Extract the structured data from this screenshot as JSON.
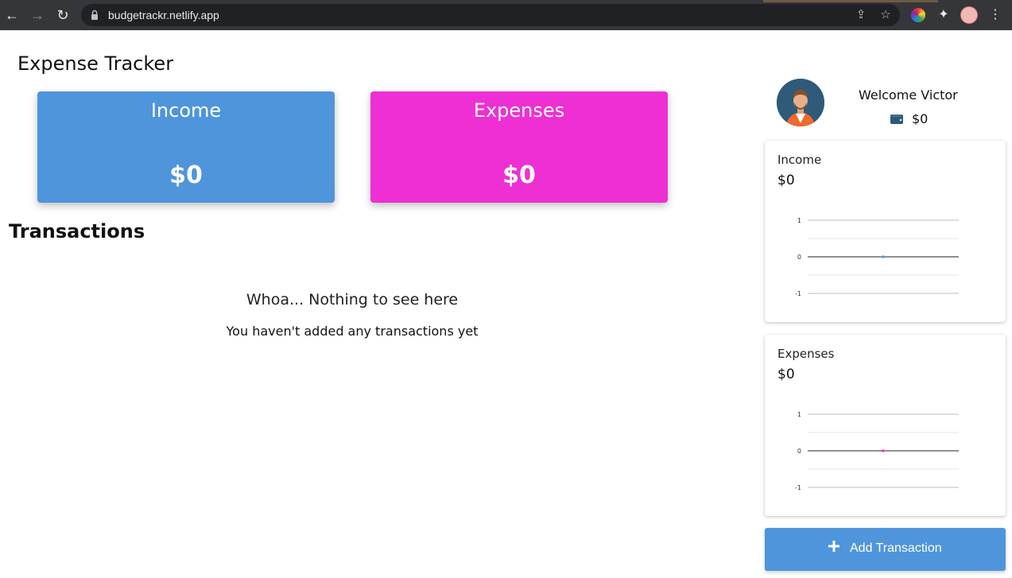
{
  "browser": {
    "url": "budgetrackr.netlify.app"
  },
  "header": {
    "title": "Expense Tracker"
  },
  "summary": {
    "income_label": "Income",
    "income_value": "$0",
    "expenses_label": "Expenses",
    "expenses_value": "$0",
    "income_color": "#4f95dc",
    "expenses_color": "#ee2fd4"
  },
  "transactions": {
    "title": "Transactions",
    "empty_title": "Whoa... Nothing to see here",
    "empty_subtitle": "You haven't added any transactions yet"
  },
  "sidebar": {
    "welcome": "Welcome Victor",
    "wallet_balance": "$0",
    "income_card": {
      "label": "Income",
      "value": "$0"
    },
    "expenses_card": {
      "label": "Expenses",
      "value": "$0"
    },
    "add_button_label": "Add Transaction"
  },
  "chart_data": [
    {
      "type": "line",
      "x": [
        0
      ],
      "y": [
        0
      ],
      "ylim": [
        -1,
        1
      ],
      "yticks": [
        "1",
        "0",
        "-1"
      ],
      "color": "#4f95dc"
    },
    {
      "type": "line",
      "x": [
        0
      ],
      "y": [
        0
      ],
      "ylim": [
        -1,
        1
      ],
      "yticks": [
        "1",
        "0",
        "-1"
      ],
      "color": "#ee2fd4"
    }
  ]
}
